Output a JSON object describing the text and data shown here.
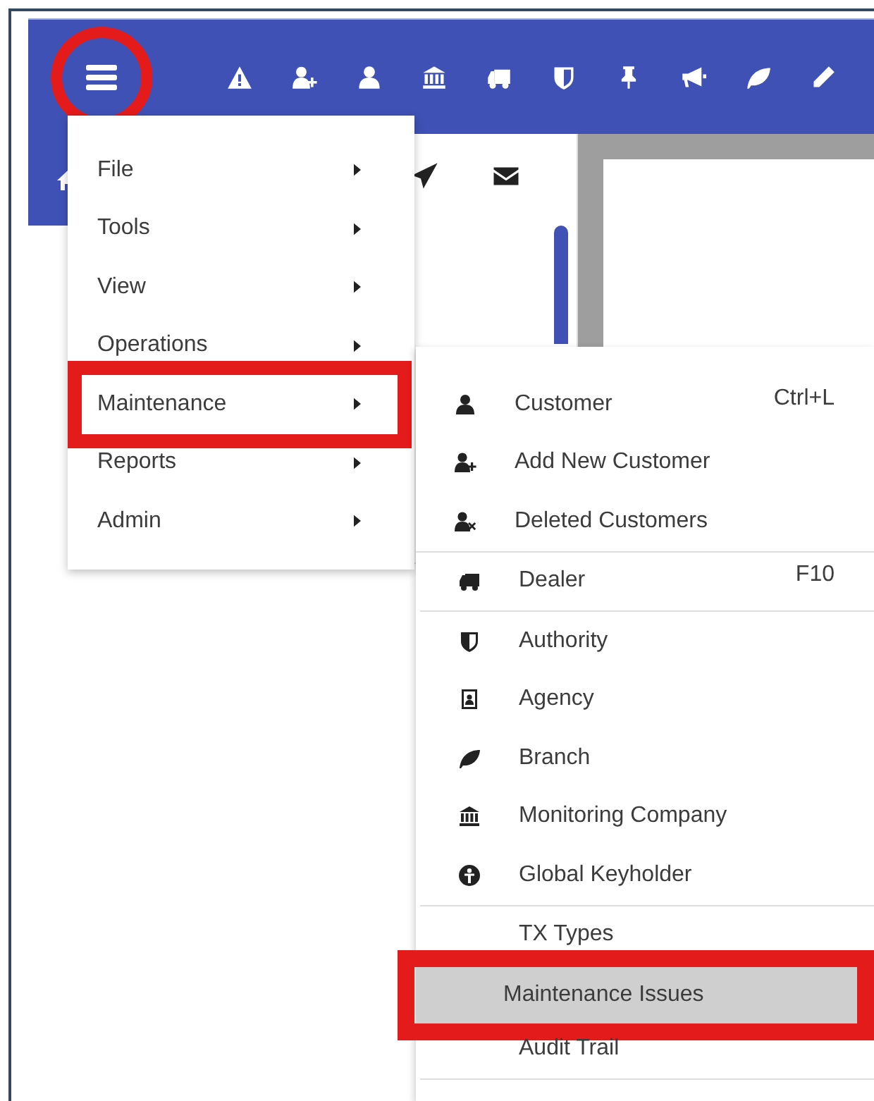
{
  "toolbar": {
    "menu_button": {
      "annotated": true
    },
    "icons": [
      {
        "kind": "warning"
      },
      {
        "kind": "user-plus"
      },
      {
        "kind": "user"
      },
      {
        "kind": "bank"
      },
      {
        "kind": "truck"
      },
      {
        "kind": "shield"
      },
      {
        "kind": "pin"
      },
      {
        "kind": "megaphone"
      },
      {
        "kind": "leaf"
      },
      {
        "kind": "pencil"
      }
    ]
  },
  "sidebar": {
    "icons": [
      {
        "kind": "home"
      }
    ]
  },
  "panel": {
    "icons": [
      {
        "kind": "send"
      },
      {
        "kind": "envelope"
      }
    ]
  },
  "menu": {
    "items": [
      {
        "label": "File",
        "has_submenu": true,
        "annotated": false
      },
      {
        "label": "Tools",
        "has_submenu": true,
        "annotated": false
      },
      {
        "label": "View",
        "has_submenu": true,
        "annotated": false
      },
      {
        "label": "Operations",
        "has_submenu": true,
        "annotated": false
      },
      {
        "label": "Maintenance",
        "has_submenu": true,
        "annotated": true
      },
      {
        "label": "Reports",
        "has_submenu": true,
        "annotated": false
      },
      {
        "label": "Admin",
        "has_submenu": true,
        "annotated": false
      }
    ]
  },
  "submenu": {
    "groups": [
      {
        "items": [
          {
            "kind": "user",
            "label": "Customer",
            "shortcut": "Ctrl+L",
            "selected": false,
            "annotated": false
          },
          {
            "kind": "user-plus",
            "label": "Add New Customer",
            "selected": false,
            "annotated": false
          },
          {
            "kind": "user-x",
            "label": "Deleted Customers",
            "selected": false,
            "annotated": false
          }
        ]
      },
      {
        "items": [
          {
            "kind": "truck",
            "label": "Dealer",
            "shortcut": "F10",
            "selected": false,
            "annotated": false
          }
        ]
      },
      {
        "items": [
          {
            "kind": "shield",
            "label": "Authority",
            "selected": false,
            "annotated": false
          },
          {
            "kind": "id-card",
            "label": "Agency",
            "selected": false,
            "annotated": false
          },
          {
            "kind": "leaf",
            "label": "Branch",
            "selected": false,
            "annotated": false
          },
          {
            "kind": "bank",
            "label": "Monitoring Company",
            "selected": false,
            "annotated": false
          },
          {
            "kind": "person-circle",
            "label": "Global Keyholder",
            "selected": false,
            "annotated": false
          }
        ]
      },
      {
        "items": [
          {
            "kind": "plain",
            "label": "TX Types",
            "selected": false,
            "annotated": false
          },
          {
            "kind": "plain",
            "label": "Maintenance Issues",
            "selected": true,
            "annotated": true
          },
          {
            "kind": "plain",
            "label": "Audit Trail",
            "selected": false,
            "annotated": false
          }
        ]
      }
    ]
  }
}
